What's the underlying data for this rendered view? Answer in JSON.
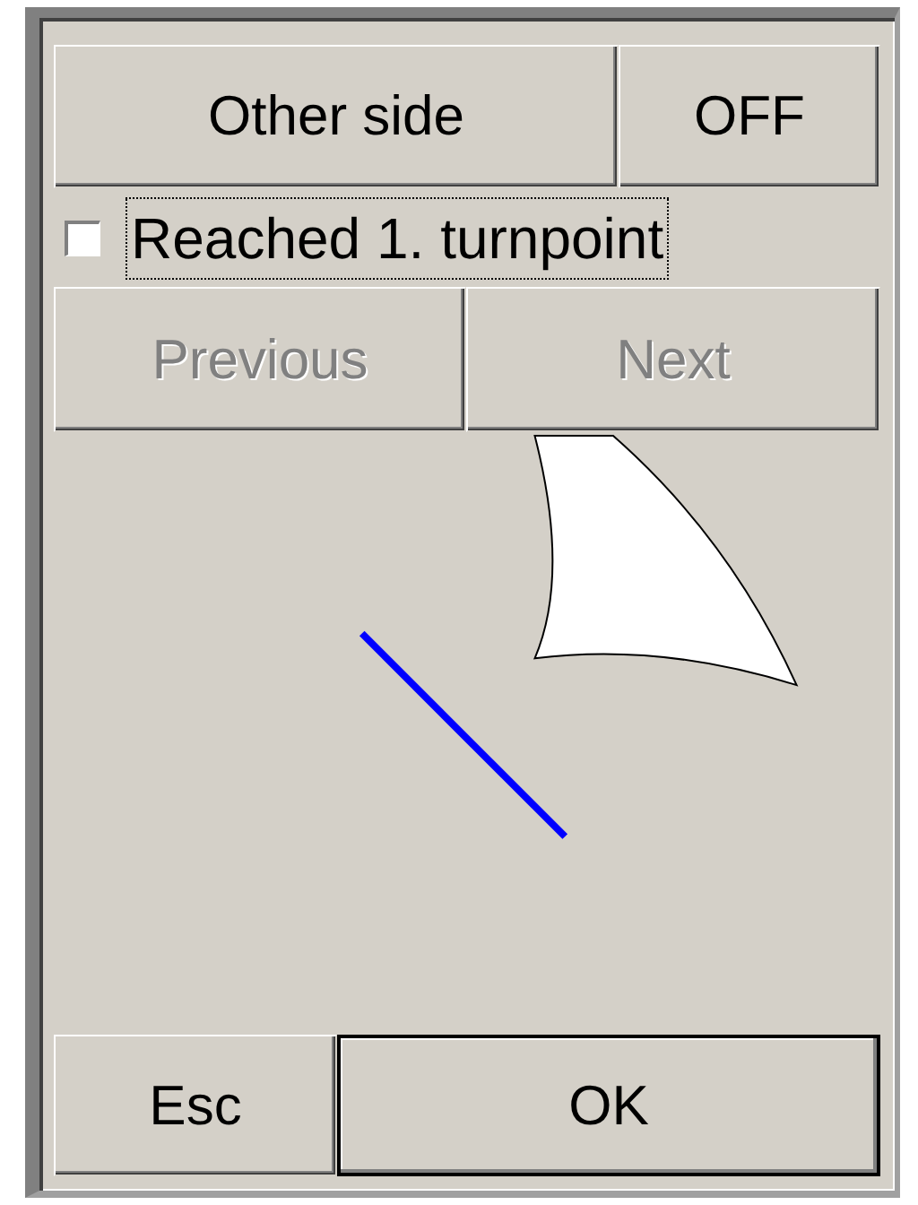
{
  "top_buttons": [
    {
      "label": "Other side",
      "kind": "wide"
    },
    {
      "label": "OFF",
      "kind": "narrow"
    }
  ],
  "checkbox": {
    "label": "Reached 1. turnpoint",
    "checked": false,
    "focused": true
  },
  "nav_buttons": [
    {
      "label": "Previous",
      "disabled": true
    },
    {
      "label": "Next",
      "disabled": true
    }
  ],
  "bottom_buttons": [
    {
      "label": "Esc",
      "default": false
    },
    {
      "label": "OK",
      "default": true
    }
  ]
}
